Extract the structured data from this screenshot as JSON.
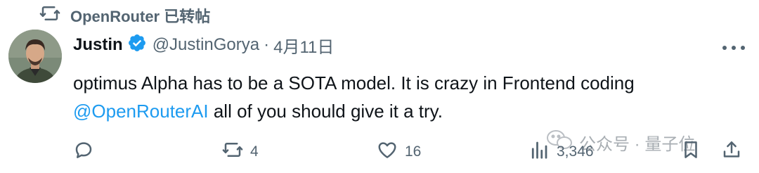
{
  "retweet": {
    "text": "OpenRouter 已转帖",
    "icon": "retweet-icon"
  },
  "author": {
    "name": "Justin",
    "handle": "@JustinGorya",
    "separator": "·",
    "date": "4月11日",
    "verified": true,
    "verified_color": "#1d9bf0",
    "avatar": "avatar-photo"
  },
  "tweet": {
    "line1": "optimus Alpha has to be a SOTA model. It is crazy in Frontend coding",
    "mention": "@OpenRouterAI",
    "line2_rest": " all of you should give it a try."
  },
  "actions": {
    "reply": {
      "icon": "reply-icon",
      "count": ""
    },
    "retweet": {
      "icon": "retweet-icon",
      "count": "4"
    },
    "like": {
      "icon": "heart-icon",
      "count": "16"
    },
    "views": {
      "icon": "views-icon",
      "count": "3,346"
    },
    "bookmark": {
      "icon": "bookmark-icon"
    },
    "share": {
      "icon": "share-icon"
    }
  },
  "watermark": {
    "text": "公众号 · 量子位",
    "icon": "wechat-icon"
  },
  "colors": {
    "accent": "#1d9bf0",
    "muted": "#536471",
    "text": "#0f1419"
  }
}
